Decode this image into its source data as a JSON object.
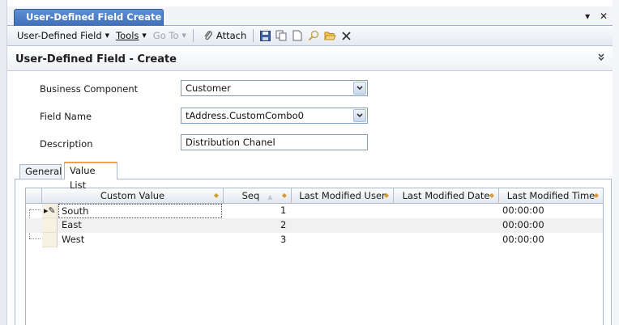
{
  "tab": {
    "title": "User-Defined Field Create"
  },
  "toolbar": {
    "menu_udf": "User-Defined Field",
    "menu_tools": "Tools",
    "menu_goto": "Go To",
    "attach_label": "Attach"
  },
  "header": {
    "title": "User-Defined Field - Create"
  },
  "form": {
    "business_component_label": "Business Component",
    "business_component_value": "Customer",
    "field_name_label": "Field Name",
    "field_name_value": "tAddress.CustomCombo0",
    "description_label": "Description",
    "description_value": "Distribution Chanel"
  },
  "subtabs": [
    "General",
    "Value List"
  ],
  "active_subtab": "Value List",
  "grid": {
    "columns": [
      "Custom Value",
      "Seq",
      "Last Modified User",
      "Last Modified Date",
      "Last Modified Time"
    ],
    "rows": [
      {
        "custom_value": "South",
        "seq": "1",
        "user": "",
        "date": "",
        "time": "00:00:00"
      },
      {
        "custom_value": "East",
        "seq": "2",
        "user": "",
        "date": "",
        "time": "00:00:00"
      },
      {
        "custom_value": "West",
        "seq": "3",
        "user": "",
        "date": "",
        "time": "00:00:00"
      }
    ]
  },
  "colors": {
    "tab_blue": "#4a7cc4",
    "accent_orange": "#f0a640",
    "sort_arrow": "#d79a2d"
  },
  "icons": [
    "chevron-down-icon",
    "close-icon",
    "paperclip-icon",
    "save-icon",
    "copy-icon",
    "new-document-icon",
    "search-icon",
    "open-folder-icon",
    "delete-icon",
    "double-chevron-down-icon",
    "edit-pencil-icon"
  ]
}
